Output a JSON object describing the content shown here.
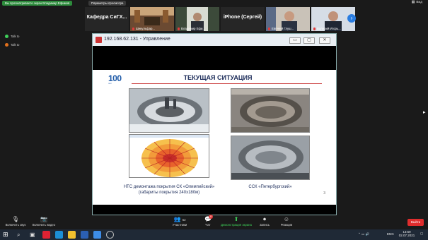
{
  "topbar": {
    "share_status": "Вы просматриваете экран Владимир Ефимов",
    "options_label": "Параметры просмотра",
    "view_label": "Вид"
  },
  "participants": [
    {
      "name": "Кафедра СиГХ...",
      "type": "text"
    },
    {
      "name": "Шикульфар...",
      "type": "photo"
    },
    {
      "name": "Владимир Ефи...",
      "type": "photo"
    },
    {
      "name": "iPhone (Сергей)",
      "type": "text"
    },
    {
      "name": "Евгений Глуш...",
      "type": "photo"
    },
    {
      "name": "Валерий Игорь...",
      "type": "photo"
    }
  ],
  "side": {
    "label_1": "Talk to",
    "label_2": "Talk to"
  },
  "window": {
    "title": "192.168.62.131 - Управление",
    "btn_min": "▭",
    "btn_max": "▢",
    "btn_close": "✕"
  },
  "slide": {
    "logo": "100",
    "logo_sub": "лет",
    "title": "ТЕКУЩАЯ СИТУАЦИЯ",
    "caption_left_1": "НТС демонтажа покрытия СК «Олимпийский»",
    "caption_left_2": "(габариты покрытия  240х180м)",
    "caption_right": "ССК «Петербургский»",
    "page_number": "3"
  },
  "controls": {
    "mute_label": "Включить звук",
    "video_label": "Включить видео",
    "participants_label": "Участники",
    "participants_count": "52",
    "chat_label": "Чат",
    "chat_badge": "9",
    "share_label": "Демонстрация экрана",
    "record_label": "Запись",
    "reactions_label": "Реакции",
    "leave_label": "Выйти"
  },
  "taskbar": {
    "lang": "ENG",
    "time": "13:59",
    "date": "02.07.2021"
  },
  "colors": {
    "accent_green": "#2d8c3c",
    "leave_red": "#e02d2d",
    "zoom_blue": "#2a7de1"
  }
}
